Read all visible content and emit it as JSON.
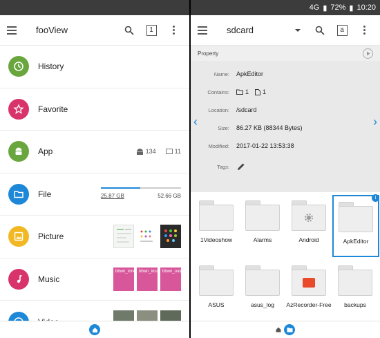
{
  "status": {
    "battery": "72%",
    "time": "10:20",
    "network": "4G"
  },
  "left": {
    "title": "fooView",
    "tab_count": "1",
    "categories": [
      {
        "label": "History",
        "color": "#6aa63e"
      },
      {
        "label": "Favorite",
        "color": "#d8336a"
      },
      {
        "label": "App",
        "color": "#6aa63e",
        "apps_count": "134",
        "other_count": "11"
      },
      {
        "label": "File",
        "color": "#1e88d8",
        "used": "25.87 GB",
        "total": "52.66 GB",
        "used_fraction": 0.49
      },
      {
        "label": "Picture",
        "color": "#f2b824"
      },
      {
        "label": "Music",
        "color": "#d8336a",
        "thumbs": [
          "bbwn_tone.wav",
          "bbwn_incoming_call",
          "bbwn_outgoing_callw"
        ]
      },
      {
        "label": "Video",
        "color": "#1e88d8"
      }
    ]
  },
  "right": {
    "title": "sdcard",
    "tab_letter": "a",
    "property": {
      "header": "Property",
      "name_key": "Name:",
      "name": "ApkEditor",
      "contains_key": "Contains:",
      "folders": "1",
      "files": "1",
      "location_key": "Location:",
      "location": "/sdcard",
      "size_key": "Size:",
      "size": "86.27 KB (88344 Bytes)",
      "modified_key": "Modified:",
      "modified": "2017-01-22 13:53:38",
      "tags_key": "Tags:"
    },
    "folders": [
      {
        "label": "1Videoshow"
      },
      {
        "label": "Alarms"
      },
      {
        "label": "Android",
        "icon": "gear-icon"
      },
      {
        "label": "ApkEditor",
        "selected": true
      },
      {
        "label": "ASUS"
      },
      {
        "label": "asus_log"
      },
      {
        "label": "AzRecorder-Free",
        "icon": "recorder-icon"
      },
      {
        "label": "backups"
      }
    ]
  },
  "colors": {
    "accent": "#1e88d8"
  }
}
